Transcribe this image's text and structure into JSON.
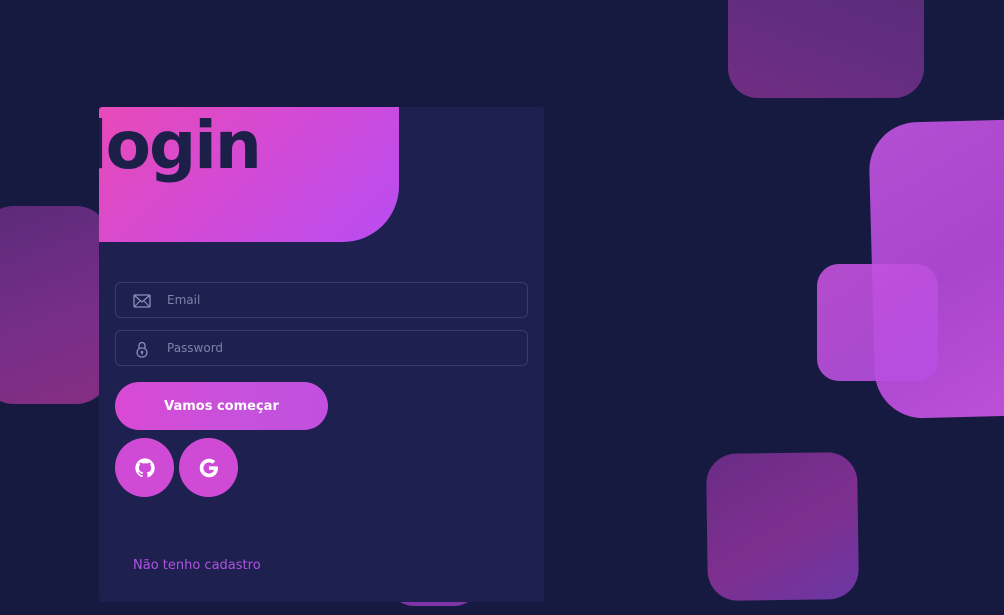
{
  "login": {
    "title": "login",
    "email": {
      "placeholder": "Email",
      "value": ""
    },
    "password": {
      "placeholder": "Password",
      "value": ""
    },
    "submit_label": "Vamos começar",
    "social": {
      "github_icon": "github-icon",
      "google_icon": "google-icon"
    },
    "register_link": "Não tenho cadastro"
  },
  "colors": {
    "background": "#171a40",
    "card": "#1e2150",
    "accent_pink": "#e84ab8",
    "accent_purple": "#b84df2",
    "link": "#b052e0"
  }
}
